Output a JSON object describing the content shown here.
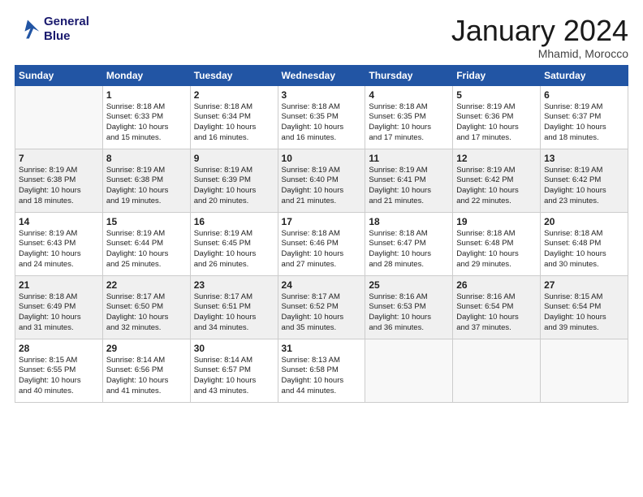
{
  "logo": {
    "line1": "General",
    "line2": "Blue"
  },
  "title": "January 2024",
  "subtitle": "Mhamid, Morocco",
  "header": {
    "days": [
      "Sunday",
      "Monday",
      "Tuesday",
      "Wednesday",
      "Thursday",
      "Friday",
      "Saturday"
    ]
  },
  "weeks": [
    [
      {
        "num": "",
        "info": ""
      },
      {
        "num": "1",
        "info": "Sunrise: 8:18 AM\nSunset: 6:33 PM\nDaylight: 10 hours\nand 15 minutes."
      },
      {
        "num": "2",
        "info": "Sunrise: 8:18 AM\nSunset: 6:34 PM\nDaylight: 10 hours\nand 16 minutes."
      },
      {
        "num": "3",
        "info": "Sunrise: 8:18 AM\nSunset: 6:35 PM\nDaylight: 10 hours\nand 16 minutes."
      },
      {
        "num": "4",
        "info": "Sunrise: 8:18 AM\nSunset: 6:35 PM\nDaylight: 10 hours\nand 17 minutes."
      },
      {
        "num": "5",
        "info": "Sunrise: 8:19 AM\nSunset: 6:36 PM\nDaylight: 10 hours\nand 17 minutes."
      },
      {
        "num": "6",
        "info": "Sunrise: 8:19 AM\nSunset: 6:37 PM\nDaylight: 10 hours\nand 18 minutes."
      }
    ],
    [
      {
        "num": "7",
        "info": "Sunrise: 8:19 AM\nSunset: 6:38 PM\nDaylight: 10 hours\nand 18 minutes."
      },
      {
        "num": "8",
        "info": "Sunrise: 8:19 AM\nSunset: 6:38 PM\nDaylight: 10 hours\nand 19 minutes."
      },
      {
        "num": "9",
        "info": "Sunrise: 8:19 AM\nSunset: 6:39 PM\nDaylight: 10 hours\nand 20 minutes."
      },
      {
        "num": "10",
        "info": "Sunrise: 8:19 AM\nSunset: 6:40 PM\nDaylight: 10 hours\nand 21 minutes."
      },
      {
        "num": "11",
        "info": "Sunrise: 8:19 AM\nSunset: 6:41 PM\nDaylight: 10 hours\nand 21 minutes."
      },
      {
        "num": "12",
        "info": "Sunrise: 8:19 AM\nSunset: 6:42 PM\nDaylight: 10 hours\nand 22 minutes."
      },
      {
        "num": "13",
        "info": "Sunrise: 8:19 AM\nSunset: 6:42 PM\nDaylight: 10 hours\nand 23 minutes."
      }
    ],
    [
      {
        "num": "14",
        "info": "Sunrise: 8:19 AM\nSunset: 6:43 PM\nDaylight: 10 hours\nand 24 minutes."
      },
      {
        "num": "15",
        "info": "Sunrise: 8:19 AM\nSunset: 6:44 PM\nDaylight: 10 hours\nand 25 minutes."
      },
      {
        "num": "16",
        "info": "Sunrise: 8:19 AM\nSunset: 6:45 PM\nDaylight: 10 hours\nand 26 minutes."
      },
      {
        "num": "17",
        "info": "Sunrise: 8:18 AM\nSunset: 6:46 PM\nDaylight: 10 hours\nand 27 minutes."
      },
      {
        "num": "18",
        "info": "Sunrise: 8:18 AM\nSunset: 6:47 PM\nDaylight: 10 hours\nand 28 minutes."
      },
      {
        "num": "19",
        "info": "Sunrise: 8:18 AM\nSunset: 6:48 PM\nDaylight: 10 hours\nand 29 minutes."
      },
      {
        "num": "20",
        "info": "Sunrise: 8:18 AM\nSunset: 6:48 PM\nDaylight: 10 hours\nand 30 minutes."
      }
    ],
    [
      {
        "num": "21",
        "info": "Sunrise: 8:18 AM\nSunset: 6:49 PM\nDaylight: 10 hours\nand 31 minutes."
      },
      {
        "num": "22",
        "info": "Sunrise: 8:17 AM\nSunset: 6:50 PM\nDaylight: 10 hours\nand 32 minutes."
      },
      {
        "num": "23",
        "info": "Sunrise: 8:17 AM\nSunset: 6:51 PM\nDaylight: 10 hours\nand 34 minutes."
      },
      {
        "num": "24",
        "info": "Sunrise: 8:17 AM\nSunset: 6:52 PM\nDaylight: 10 hours\nand 35 minutes."
      },
      {
        "num": "25",
        "info": "Sunrise: 8:16 AM\nSunset: 6:53 PM\nDaylight: 10 hours\nand 36 minutes."
      },
      {
        "num": "26",
        "info": "Sunrise: 8:16 AM\nSunset: 6:54 PM\nDaylight: 10 hours\nand 37 minutes."
      },
      {
        "num": "27",
        "info": "Sunrise: 8:15 AM\nSunset: 6:54 PM\nDaylight: 10 hours\nand 39 minutes."
      }
    ],
    [
      {
        "num": "28",
        "info": "Sunrise: 8:15 AM\nSunset: 6:55 PM\nDaylight: 10 hours\nand 40 minutes."
      },
      {
        "num": "29",
        "info": "Sunrise: 8:14 AM\nSunset: 6:56 PM\nDaylight: 10 hours\nand 41 minutes."
      },
      {
        "num": "30",
        "info": "Sunrise: 8:14 AM\nSunset: 6:57 PM\nDaylight: 10 hours\nand 43 minutes."
      },
      {
        "num": "31",
        "info": "Sunrise: 8:13 AM\nSunset: 6:58 PM\nDaylight: 10 hours\nand 44 minutes."
      },
      {
        "num": "",
        "info": ""
      },
      {
        "num": "",
        "info": ""
      },
      {
        "num": "",
        "info": ""
      }
    ]
  ]
}
